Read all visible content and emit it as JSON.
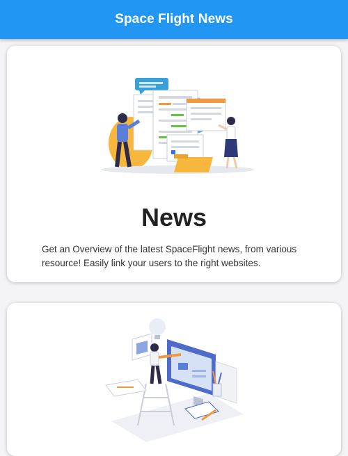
{
  "app": {
    "title": "Space Flight News",
    "accent_color": "#2196f3"
  },
  "cards": [
    {
      "title": "News",
      "description": "Get an Overview of the latest SpaceFlight news, from various resource! Easily link your users to the right websites.",
      "illustration": "news-illustration"
    },
    {
      "illustration": "design-illustration"
    }
  ]
}
